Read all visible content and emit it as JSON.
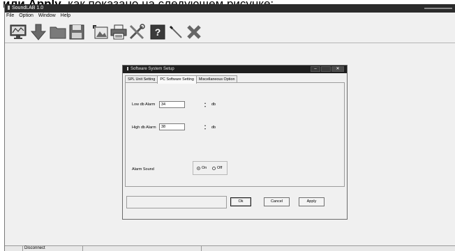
{
  "caption": {
    "bold_text": "или Apply",
    "rest_text": ", как показано на следующем рисунке:"
  },
  "app": {
    "title": "SoundLAB 1.0",
    "menu": [
      "File",
      "Option",
      "Window",
      "Help"
    ],
    "toolbar": [
      {
        "icon": "monitor-icon"
      },
      {
        "icon": "download-arrow-icon"
      },
      {
        "icon": "folder-icon"
      },
      {
        "icon": "save-floppy-icon"
      },
      {
        "icon": "image-import-icon"
      },
      {
        "icon": "printer-icon"
      },
      {
        "icon": "tools-icon"
      },
      {
        "icon": "help-icon"
      },
      {
        "icon": "pen-icon"
      },
      {
        "icon": "close-x-icon"
      }
    ],
    "status": {
      "cell2": "Disconnect"
    }
  },
  "dialog": {
    "title": "Software System Setup",
    "tabs": [
      "SPL Unit Setting",
      "PC Software Setting",
      "Miscellaneous Option"
    ],
    "active_tab": "PC Software Setting",
    "low_alarm": {
      "label": "Low db Alarm",
      "value": "34",
      "unit": "db"
    },
    "high_alarm": {
      "label": "High db Alarm",
      "value": "38",
      "unit": "db"
    },
    "alarm_sound": {
      "label": "Alarm Sound",
      "on_label": "On",
      "off_label": "Off",
      "selected": "On"
    },
    "buttons": {
      "ok": "Ok",
      "cancel": "Cancel",
      "apply": "Apply"
    }
  }
}
